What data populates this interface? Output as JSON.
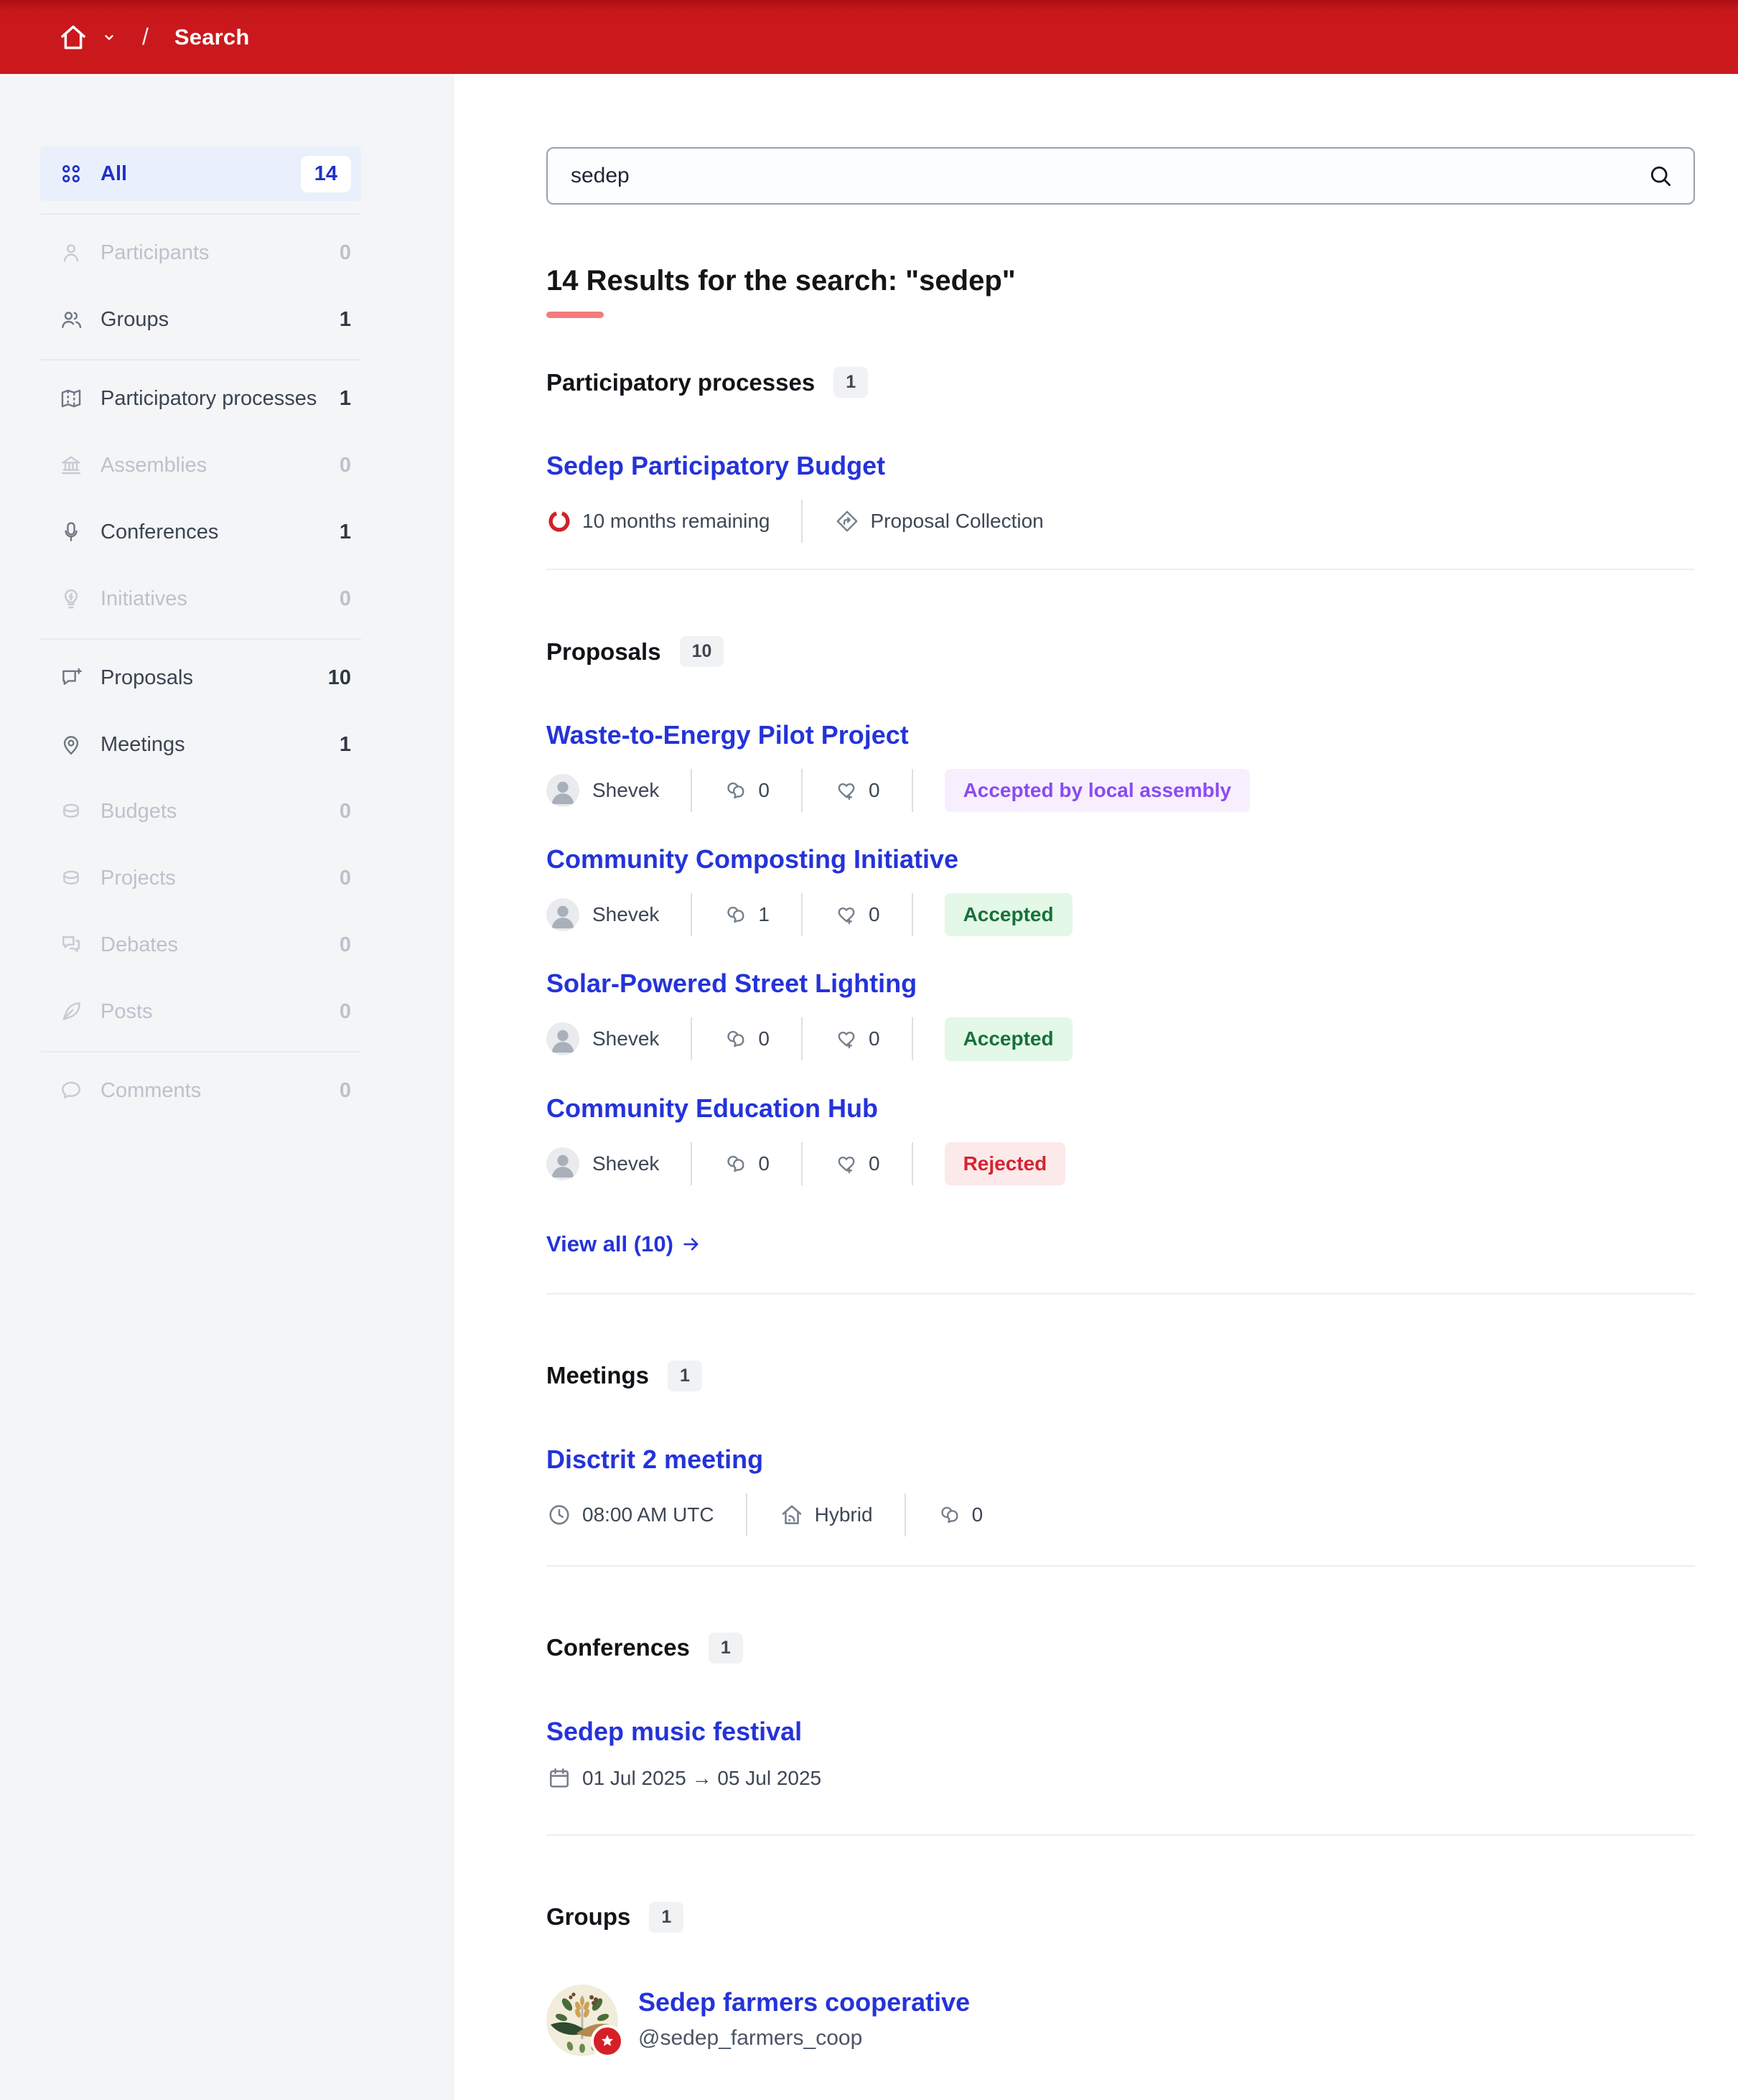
{
  "breadcrumb": {
    "page": "Search"
  },
  "search": {
    "value": "sedep"
  },
  "heading": {
    "text": "14 Results for the search: \"sedep\""
  },
  "colors": {
    "header_red": "#c9181b",
    "link_blue": "#2433d9",
    "sidebar_active_bg": "#e9f0fc",
    "accent_underline": "#f47c7c",
    "success_text": "#17713a",
    "success_bg": "#e3f8e7",
    "rejected_text": "#d42431",
    "rejected_bg": "#fce9ea",
    "purple_text": "#8a4bef",
    "purple_bg": "#f7effe"
  },
  "sidebar": {
    "items": [
      {
        "label": "All",
        "count": "14",
        "icon": "grid-icon",
        "state": "active"
      },
      {
        "label": "Participants",
        "count": "0",
        "icon": "user-icon",
        "state": "disabled"
      },
      {
        "label": "Groups",
        "count": "1",
        "icon": "users-icon",
        "state": "normal"
      },
      {
        "label": "Participatory processes",
        "count": "1",
        "icon": "map-icon",
        "state": "normal"
      },
      {
        "label": "Assemblies",
        "count": "0",
        "icon": "bank-icon",
        "state": "disabled"
      },
      {
        "label": "Conferences",
        "count": "1",
        "icon": "microphone-icon",
        "state": "normal"
      },
      {
        "label": "Initiatives",
        "count": "0",
        "icon": "lightbulb-icon",
        "state": "disabled"
      },
      {
        "label": "Proposals",
        "count": "10",
        "icon": "proposal-bubble-icon",
        "state": "normal"
      },
      {
        "label": "Meetings",
        "count": "1",
        "icon": "map-pin-icon",
        "state": "normal"
      },
      {
        "label": "Budgets",
        "count": "0",
        "icon": "coin-icon",
        "state": "disabled"
      },
      {
        "label": "Projects",
        "count": "0",
        "icon": "coin-icon",
        "state": "disabled"
      },
      {
        "label": "Debates",
        "count": "0",
        "icon": "debate-bubbles-icon",
        "state": "disabled"
      },
      {
        "label": "Posts",
        "count": "0",
        "icon": "quill-icon",
        "state": "disabled"
      },
      {
        "label": "Comments",
        "count": "0",
        "icon": "chat-bubble-icon",
        "state": "disabled"
      }
    ]
  },
  "sections": {
    "processes": {
      "title": "Participatory processes",
      "count": "1",
      "items": [
        {
          "title": "Sedep Participatory Budget",
          "remaining": "10 months remaining",
          "phase": "Proposal Collection"
        }
      ]
    },
    "proposals": {
      "title": "Proposals",
      "count": "10",
      "view_all": "View all (10)",
      "items": [
        {
          "title": "Waste-to-Energy Pilot Project",
          "author": "Shevek",
          "comments": "0",
          "endorsements": "0",
          "status": "Accepted by local assembly",
          "status_type": "purple"
        },
        {
          "title": "Community Composting Initiative",
          "author": "Shevek",
          "comments": "1",
          "endorsements": "0",
          "status": "Accepted",
          "status_type": "green"
        },
        {
          "title": "Solar-Powered Street Lighting",
          "author": "Shevek",
          "comments": "0",
          "endorsements": "0",
          "status": "Accepted",
          "status_type": "green"
        },
        {
          "title": "Community Education Hub",
          "author": "Shevek",
          "comments": "0",
          "endorsements": "0",
          "status": "Rejected",
          "status_type": "red"
        }
      ]
    },
    "meetings": {
      "title": "Meetings",
      "count": "1",
      "items": [
        {
          "title": "Disctrit 2 meeting",
          "time": "08:00 AM UTC",
          "mode": "Hybrid",
          "comments": "0"
        }
      ]
    },
    "conferences": {
      "title": "Conferences",
      "count": "1",
      "items": [
        {
          "title": "Sedep music festival",
          "dates": "01 Jul 2025 → 05 Jul 2025"
        }
      ]
    },
    "groups": {
      "title": "Groups",
      "count": "1",
      "items": [
        {
          "title": "Sedep farmers cooperative",
          "handle": "@sedep_farmers_coop"
        }
      ]
    }
  }
}
